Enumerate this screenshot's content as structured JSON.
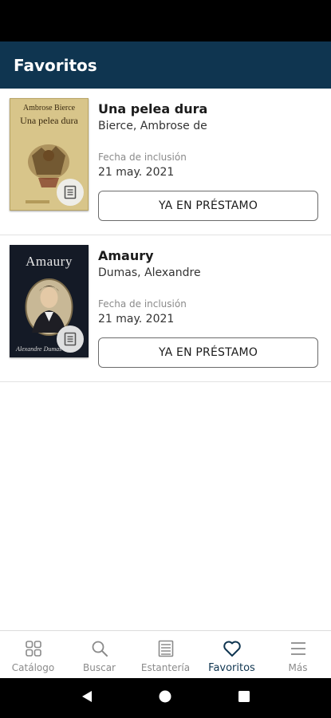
{
  "app_bar": {
    "title": "Favoritos"
  },
  "favorites": [
    {
      "title": "Una pelea dura",
      "author": "Bierce, Ambrose de",
      "cover_lines": [
        "Ambrose Bierce",
        "Una pelea dura"
      ],
      "date_label": "Fecha de inclusión",
      "date_value": "21 may. 2021",
      "button_label": "YA EN PRÉSTAMO"
    },
    {
      "title": "Amaury",
      "author": "Dumas, Alexandre",
      "cover_lines": [
        "Amaury",
        "Alexandre Dumas"
      ],
      "date_label": "Fecha de inclusión",
      "date_value": "21 may. 2021",
      "button_label": "YA EN PRÉSTAMO"
    }
  ],
  "bottom_nav": {
    "items": [
      {
        "label": "Catálogo",
        "icon": "grid-icon"
      },
      {
        "label": "Buscar",
        "icon": "search-icon"
      },
      {
        "label": "Estantería",
        "icon": "shelf-icon"
      },
      {
        "label": "Favoritos",
        "icon": "heart-icon",
        "active": true
      },
      {
        "label": "Más",
        "icon": "menu-icon"
      }
    ]
  },
  "colors": {
    "app_bar": "#0f3550",
    "active_nav": "#0f3550",
    "inactive_nav": "#8a8a8a"
  }
}
